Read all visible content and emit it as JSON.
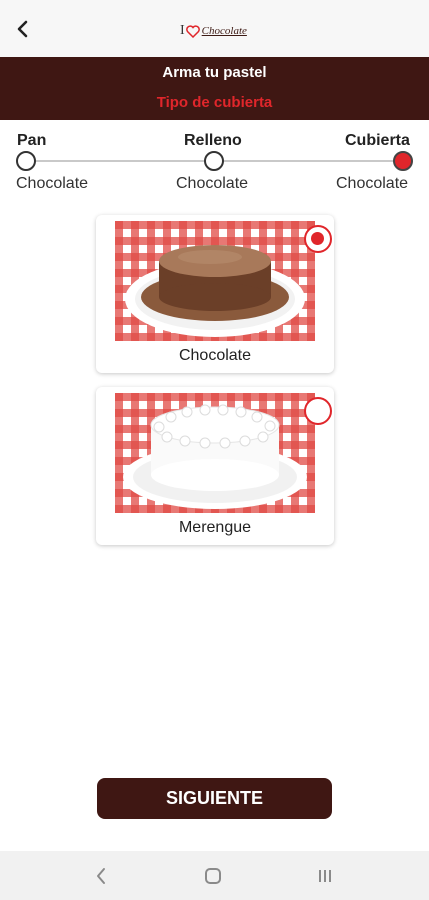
{
  "header": {
    "title": "Arma tu pastel",
    "subtitle": "Tipo de cubierta"
  },
  "logo": {
    "prefix": "I",
    "script": "Chocolate"
  },
  "steps": [
    {
      "label": "Pan",
      "value": "Chocolate",
      "active": false
    },
    {
      "label": "Relleno",
      "value": "Chocolate",
      "active": false
    },
    {
      "label": "Cubierta",
      "value": "Chocolate",
      "active": true
    }
  ],
  "options": [
    {
      "label": "Chocolate",
      "selected": true
    },
    {
      "label": "Merengue",
      "selected": false
    }
  ],
  "next_button": {
    "label": "SIGUIENTE"
  },
  "icons": {
    "back": "back-arrow-icon",
    "nav_back": "nav-back-icon",
    "nav_home": "nav-home-icon",
    "nav_recents": "nav-recents-icon"
  },
  "colors": {
    "brand_dark": "#3f1713",
    "accent_red": "#e0262b"
  }
}
